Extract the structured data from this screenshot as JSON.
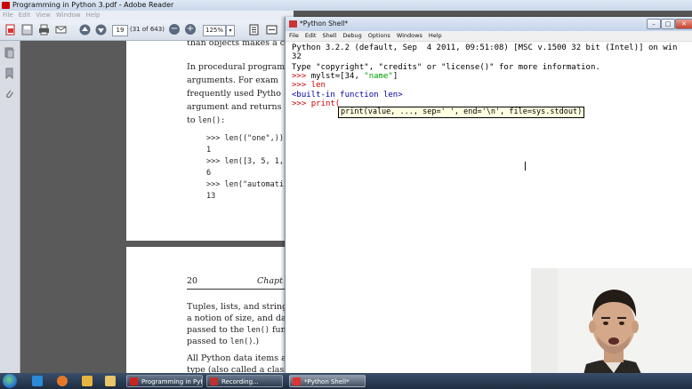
{
  "reader": {
    "title": "Programming in Python 3.pdf - Adobe Reader",
    "menu": [
      "File",
      "Edit",
      "View",
      "Window",
      "Help"
    ],
    "toolbar": {
      "page_number": "19",
      "page_count": "(31 of 643)",
      "zoom": "125%"
    },
    "page1": {
      "lines": [
        "than objects makes a c",
        "In procedural program",
        "arguments.  For exam",
        "frequently used Pytho",
        "argument and returns",
        "to "
      ],
      "to_code": "len():",
      "code": [
        ">>> len((\"one\",))",
        "1",
        ">>> len([3, 5, 1,",
        "6",
        ">>> len(\"automati",
        "13"
      ]
    },
    "page2": {
      "page_num": "20",
      "chapter": "Chapt",
      "lines": [
        "Tuples, lists, and string",
        "a notion of size, and da",
        "passed to the ",
        "passed to "
      ],
      "len_code_1": "len()",
      "suffix_1": " funct",
      "len_code_2": "len()",
      "suffix_2": ".)",
      "lines2": [
        "All Python data items a",
        "type (also called a class)"
      ]
    }
  },
  "shell": {
    "title": "*Python Shell*",
    "menu": [
      "File",
      "Edit",
      "Shell",
      "Debug",
      "Options",
      "Windows",
      "Help"
    ],
    "line1": "Python 3.2.2 (default, Sep  4 2011, 09:51:08) [MSC v.1500 32 bit (Intel)] on win",
    "line2": "32",
    "line3": "Type \"copyright\", \"credits\" or \"license()\" for more information.",
    "prompt": ">>> ",
    "cmd1_a": "mylst=[34, ",
    "cmd1_str": "\"name\"",
    "cmd1_b": "]",
    "cmd2": "len",
    "out2": "<built-in function len>",
    "cmd3": "print(",
    "calltip": "print(value, ..., sep=' ', end='\\n', file=sys.stdout)"
  },
  "taskbar": {
    "tasks": [
      "Programming in Pyt...",
      "Recording...",
      "*Python Shell*"
    ]
  },
  "colors": {
    "prompt": "#c00000",
    "string": "#00a000",
    "output": "#00009f",
    "calltip_bg": "#ffffe1"
  }
}
